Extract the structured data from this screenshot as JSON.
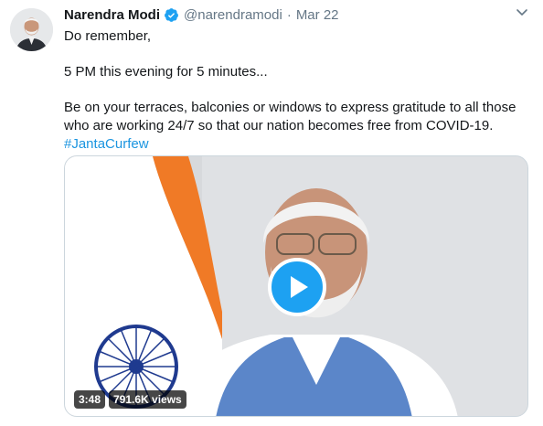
{
  "tweet": {
    "author_name": "Narendra Modi",
    "handle": "@narendramodi",
    "separator": "·",
    "date": "Mar 22",
    "line1": "Do remember,",
    "line2": "5 PM this evening for 5 minutes...",
    "line3": "Be on your terraces, balconies or windows to express gratitude to all those",
    "line4": "who are working 24/7 so that our nation becomes free from COVID-19.",
    "hashtag": "#JantaCurfew"
  },
  "video": {
    "duration": "3:48",
    "views": "791.6K views"
  },
  "colors": {
    "accent": "#1da1f2",
    "hashtag": "#1b95e0",
    "secondary_text": "#657786"
  },
  "icons": {
    "verified": "verified-badge-icon",
    "caret": "chevron-down-icon",
    "play": "play-icon"
  }
}
